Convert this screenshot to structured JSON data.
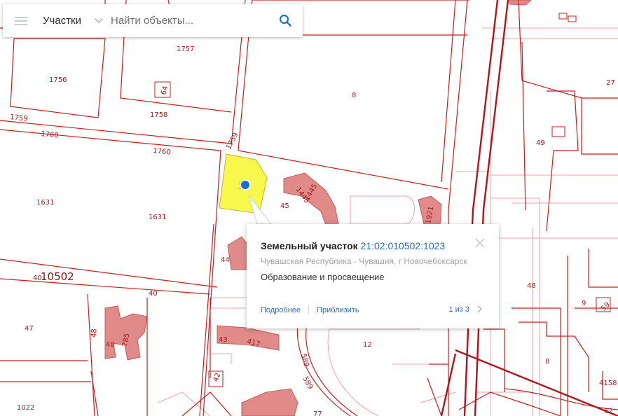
{
  "search": {
    "layer": "Участки",
    "placeholder": "Найти объекты..."
  },
  "popup": {
    "title": "Земельный участок",
    "cad_number": "21:02:010502:1023",
    "address": "Чувашская Республика - Чувашия, г Новочебоксарск",
    "land_use": "Образование и просвещение",
    "details_link": "Подробнее",
    "zoom_link": "Приблизить",
    "pager": "1 из 3"
  },
  "map": {
    "colors": {
      "boundary": "#c81e1e",
      "building": "#e28a8a",
      "selected": "#f7f74c",
      "marker": "#1a6fc4"
    },
    "labels": {
      "l1757": "1757",
      "l1756": "1756",
      "l1758": "1758",
      "l64": "64",
      "l1759a": "1759",
      "l1760a": "1760",
      "l1760b": "1760",
      "l1759b": "1759",
      "l8a": "8",
      "l27": "27",
      "l49": "49",
      "l1631a": "1631",
      "l1631b": "1631",
      "l1": "1",
      "l45": "45",
      "l1445a": "1445",
      "l1445b": "1445",
      "l1921": "1921",
      "l44": "44",
      "l10502": "10502",
      "l40a": "40",
      "l40b": "40",
      "l47": "47",
      "l48a": "48",
      "l48b": "48",
      "l785": "785",
      "l43": "43",
      "l417": "417",
      "l48c": "48",
      "l9": "9",
      "l59": "59",
      "l12": "12",
      "l8b": "8",
      "l589a": "589",
      "l589b": "589",
      "l77": "77",
      "l1022": "1022",
      "l42": "42",
      "l4158": "4158",
      "l52": "52"
    }
  }
}
